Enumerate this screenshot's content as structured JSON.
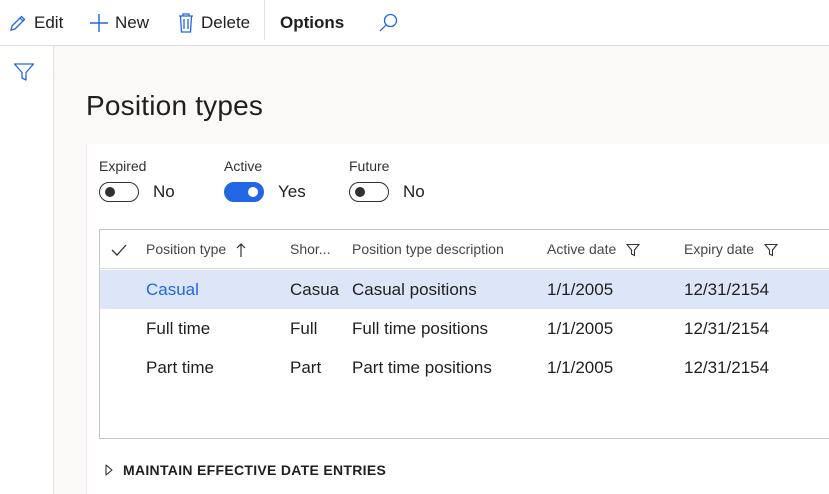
{
  "toolbar": {
    "edit_label": "Edit",
    "new_label": "New",
    "delete_label": "Delete",
    "options_label": "Options"
  },
  "page": {
    "title": "Position types"
  },
  "filters": [
    {
      "label": "Expired",
      "value": "No",
      "on": false
    },
    {
      "label": "Active",
      "value": "Yes",
      "on": true
    },
    {
      "label": "Future",
      "value": "No",
      "on": false
    }
  ],
  "grid": {
    "columns": [
      "Position type",
      "Shor...",
      "Position type description",
      "Active date",
      "Expiry date"
    ],
    "rows": [
      {
        "type": "Casual",
        "short": "Casua",
        "description": "Casual positions",
        "active": "1/1/2005",
        "expiry": "12/31/2154",
        "selected": true
      },
      {
        "type": "Full time",
        "short": "Full",
        "description": "Full time positions",
        "active": "1/1/2005",
        "expiry": "12/31/2154",
        "selected": false
      },
      {
        "type": "Part time",
        "short": "Part",
        "description": "Part time positions",
        "active": "1/1/2005",
        "expiry": "12/31/2154",
        "selected": false
      }
    ]
  },
  "section": {
    "label": "MAINTAIN EFFECTIVE DATE ENTRIES"
  },
  "colors": {
    "accent": "#2266e3",
    "selected_row": "#dce6f8"
  }
}
